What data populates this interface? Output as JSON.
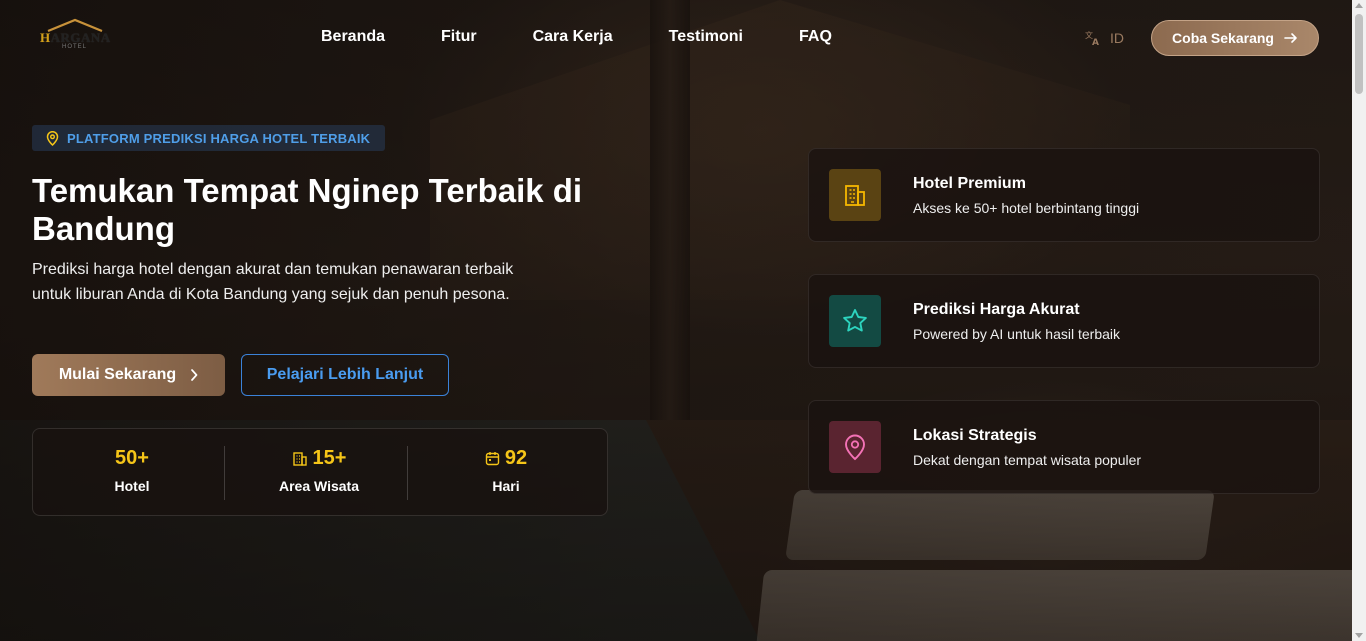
{
  "brand": {
    "logo_main": "HARGANA",
    "logo_initial": "H",
    "logo_rest": "ARGANA",
    "logo_sub": "HOTEL"
  },
  "nav": {
    "items": [
      {
        "label": "Beranda"
      },
      {
        "label": "Fitur"
      },
      {
        "label": "Cara Kerja"
      },
      {
        "label": "Testimoni"
      },
      {
        "label": "FAQ"
      }
    ],
    "language": "ID",
    "language_icon": "translate-icon",
    "cta_label": "Coba Sekarang"
  },
  "hero": {
    "badge_icon": "map-pin-icon",
    "badge": "PLATFORM PREDIKSI HARGA HOTEL TERBAIK",
    "title": "Temukan Tempat Nginep Terbaik di Bandung",
    "description": "Prediksi harga hotel dengan akurat dan temukan penawaran terbaik untuk liburan Anda di Kota Bandung yang sejuk dan penuh pesona.",
    "primary_button": "Mulai Sekarang",
    "secondary_button": "Pelajari Lebih Lanjut"
  },
  "stats": [
    {
      "value": "50+",
      "label": "Hotel",
      "icon": ""
    },
    {
      "value": "15+",
      "label": "Area Wisata",
      "icon": "building-icon"
    },
    {
      "value": "92",
      "label": "Hari",
      "icon": "calendar-icon"
    }
  ],
  "features": [
    {
      "title": "Hotel Premium",
      "desc": "Akses ke 50+ hotel berbintang tinggi",
      "icon": "building-icon",
      "color": "#f5b800"
    },
    {
      "title": "Prediksi Harga Akurat",
      "desc": "Powered by AI untuk hasil terbaik",
      "icon": "star-icon",
      "color": "#2dd4bf"
    },
    {
      "title": "Lokasi Strategis",
      "desc": "Dekat dengan tempat wisata populer",
      "icon": "map-pin-icon",
      "color": "#f472b6"
    }
  ],
  "colors": {
    "accent_gold": "#f5c518",
    "accent_blue": "#4a9cf0",
    "brand_brown": "#8c6a4f"
  }
}
